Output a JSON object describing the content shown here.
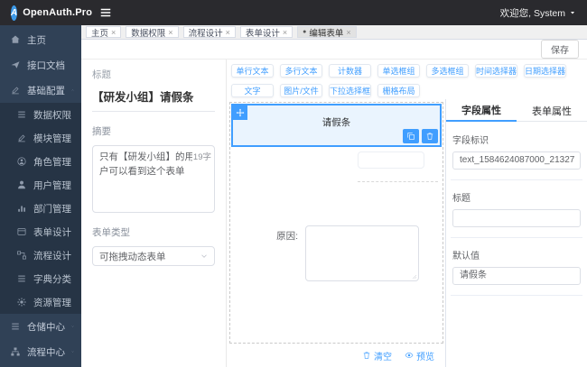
{
  "header": {
    "brand": "OpenAuth.Pro",
    "welcome": "欢迎您, System"
  },
  "tagbar": {
    "dot": "●",
    "close": "×",
    "tabs": [
      {
        "label": "主页"
      },
      {
        "label": "数据权限"
      },
      {
        "label": "流程设计"
      },
      {
        "label": "表单设计"
      },
      {
        "label": "编辑表单",
        "active": true
      }
    ]
  },
  "sidebar": {
    "home": "主页",
    "api_docs": "接口文档",
    "base_config": "基础配置",
    "submenu": [
      "数据权限",
      "模块管理",
      "角色管理",
      "用户管理",
      "部门管理",
      "表单设计",
      "流程设计",
      "字典分类",
      "资源管理"
    ],
    "warehouse": "仓储中心",
    "process": "流程中心"
  },
  "toolbar": {
    "save": "保存"
  },
  "meta": {
    "title_label": "标题",
    "title_value": "【研发小组】请假条",
    "summary_label": "摘要",
    "summary_value": "只有【研发小组】的用户可以看到这个表单",
    "summary_count": "19字",
    "type_label": "表单类型",
    "type_value": "可拖拽动态表单"
  },
  "palette": {
    "items": [
      "单行文本",
      "多行文本",
      "计数器",
      "单选框组",
      "多选框组",
      "时间选择器",
      "日期选择器",
      "文字",
      "图片/文件",
      "下拉选择框",
      "栅格布局"
    ]
  },
  "canvas": {
    "selected_text": "请假条",
    "reason_label": "原因:",
    "clear": "清空",
    "preview": "预览"
  },
  "props": {
    "tab_field": "字段属性",
    "tab_form": "表单属性",
    "field_id_label": "字段标识",
    "field_id_value": "text_1584624087000_21327",
    "title_label": "标题",
    "title_value": "",
    "default_label": "默认值",
    "default_value": "请假条"
  },
  "colors": {
    "accent": "#409eff",
    "header_bg": "#2a2a2e",
    "sidebar_bg": "#304156",
    "submenu_bg": "#263445",
    "selected_bg": "#eaf4fe"
  }
}
